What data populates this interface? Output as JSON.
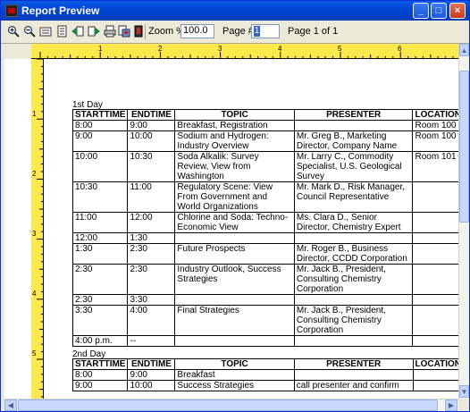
{
  "window": {
    "title": "Report Preview"
  },
  "toolbar": {
    "icons": [
      "zoom-in-icon",
      "zoom-out-icon",
      "page-width-icon",
      "full-page-icon",
      "prev-page-icon",
      "next-page-icon",
      "print-icon",
      "export-icon",
      "close-preview-icon"
    ],
    "zoom_label": "Zoom %",
    "zoom_value": "100.0",
    "page_label": "Page #",
    "page_value": "1",
    "page_status": "Page 1 of 1"
  },
  "ruler": {
    "h_numbers": [
      "1",
      "2",
      "3",
      "4",
      "5",
      "6"
    ],
    "v_numbers": [
      "1",
      "2",
      "3",
      "4",
      "5"
    ]
  },
  "report": {
    "headers": [
      "STARTTIME",
      "ENDTIME",
      "TOPIC",
      "PRESENTER",
      "LOCATION"
    ],
    "day1": {
      "title": "1st Day",
      "rows": [
        [
          "8:00",
          "9:00",
          "Breakfast, Registration",
          "",
          "Room 100"
        ],
        [
          "9:00",
          "10:00",
          "Sodium and Hydrogen: Industry Overview",
          "Mr. Greg B., Marketing Director, Company Name",
          "Room 100"
        ],
        [
          "10:00",
          "10:30",
          "Soda Alkalik: Survey Review, View from Washington",
          "Mr. Larry C., Commodity Specialist, U.S. Geological Survey",
          "Room 101"
        ],
        [
          "10:30",
          "11:00",
          "Regulatory Scene: View From Government and World Organizations",
          "Mr. Mark D., Risk Manager, Council Representative",
          ""
        ],
        [
          "11:00",
          "12:00",
          "Chlorine and Soda: Techno-Economic View",
          "Ms. Clara D., Senior Director, Chemistry Expert",
          ""
        ],
        [
          "12:00",
          "1:30",
          "",
          "",
          ""
        ],
        [
          "1:30",
          "2:30",
          "Future Prospects",
          "Mr. Roger B., Business Director, CCDD Corporation",
          ""
        ],
        [
          "2:30",
          "2:30",
          "Industry Outlook, Success Strategies",
          "Mr. Jack B., President, Consulting Chemistry Corporation",
          ""
        ],
        [
          "2:30",
          "3:30",
          "",
          "",
          ""
        ],
        [
          "3:30",
          "4:00",
          "Final Strategies",
          "Mr. Jack B., President, Consulting Chemistry Corporation",
          ""
        ],
        [
          "4:00 p.m.",
          "--",
          "",
          "",
          ""
        ]
      ]
    },
    "day2": {
      "title": "2nd Day",
      "rows": [
        [
          "8:00",
          "9:00",
          "Breakfast",
          "",
          ""
        ],
        [
          "9:00",
          "10:00",
          "Success Strategies",
          "call presenter and confirm",
          ""
        ]
      ]
    }
  }
}
